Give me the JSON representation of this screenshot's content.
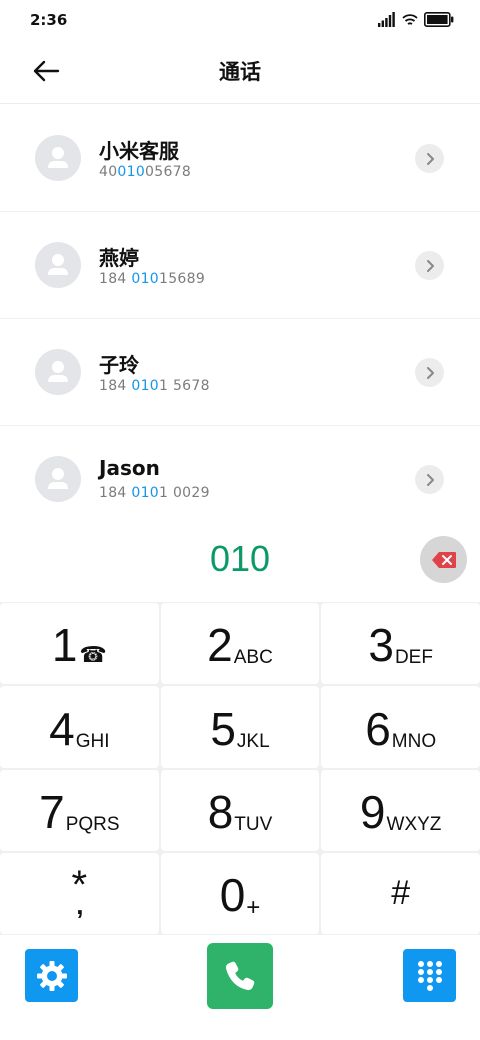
{
  "status_bar": {
    "time": "2:36",
    "icons": [
      "signal-icon",
      "wifi-icon",
      "battery-icon"
    ]
  },
  "header": {
    "title": "通话",
    "back_icon": "arrow-left-icon"
  },
  "contacts": [
    {
      "name": "小米客服",
      "number_prefix": "40",
      "number_match": "010",
      "number_suffix": "05678"
    },
    {
      "name": "燕婷",
      "number_prefix": "184 ",
      "number_match": "010",
      "number_suffix": "15689"
    },
    {
      "name": "子玲",
      "number_prefix": "184 ",
      "number_match": "010",
      "number_suffix": "1 5678"
    },
    {
      "name": "Jason",
      "number_prefix": "184 ",
      "number_match": "010",
      "number_suffix": "1 0029"
    }
  ],
  "dialer": {
    "input_value": "010",
    "backspace_icon": "backspace-icon"
  },
  "keypad": {
    "keys": [
      {
        "digit": "1",
        "letters": "☎"
      },
      {
        "digit": "2",
        "letters": "ABC"
      },
      {
        "digit": "3",
        "letters": "DEF"
      },
      {
        "digit": "4",
        "letters": "GHI"
      },
      {
        "digit": "5",
        "letters": "JKL"
      },
      {
        "digit": "6",
        "letters": "MNO"
      },
      {
        "digit": "7",
        "letters": "PQRS"
      },
      {
        "digit": "8",
        "letters": "TUV"
      },
      {
        "digit": "9",
        "letters": "WXYZ"
      },
      {
        "digit": "*",
        "letters": ","
      },
      {
        "digit": "0",
        "letters": "+"
      },
      {
        "digit": "#",
        "letters": ""
      }
    ]
  },
  "bottom_bar": {
    "settings_icon": "gear-icon",
    "call_icon": "phone-icon",
    "keypad_icon": "dialpad-icon"
  },
  "colors": {
    "accent_blue": "#1097f0",
    "highlight_blue": "#1596e8",
    "dial_green": "#0a9a66",
    "call_green": "#2fb36a",
    "backspace_red": "#e0424a"
  }
}
